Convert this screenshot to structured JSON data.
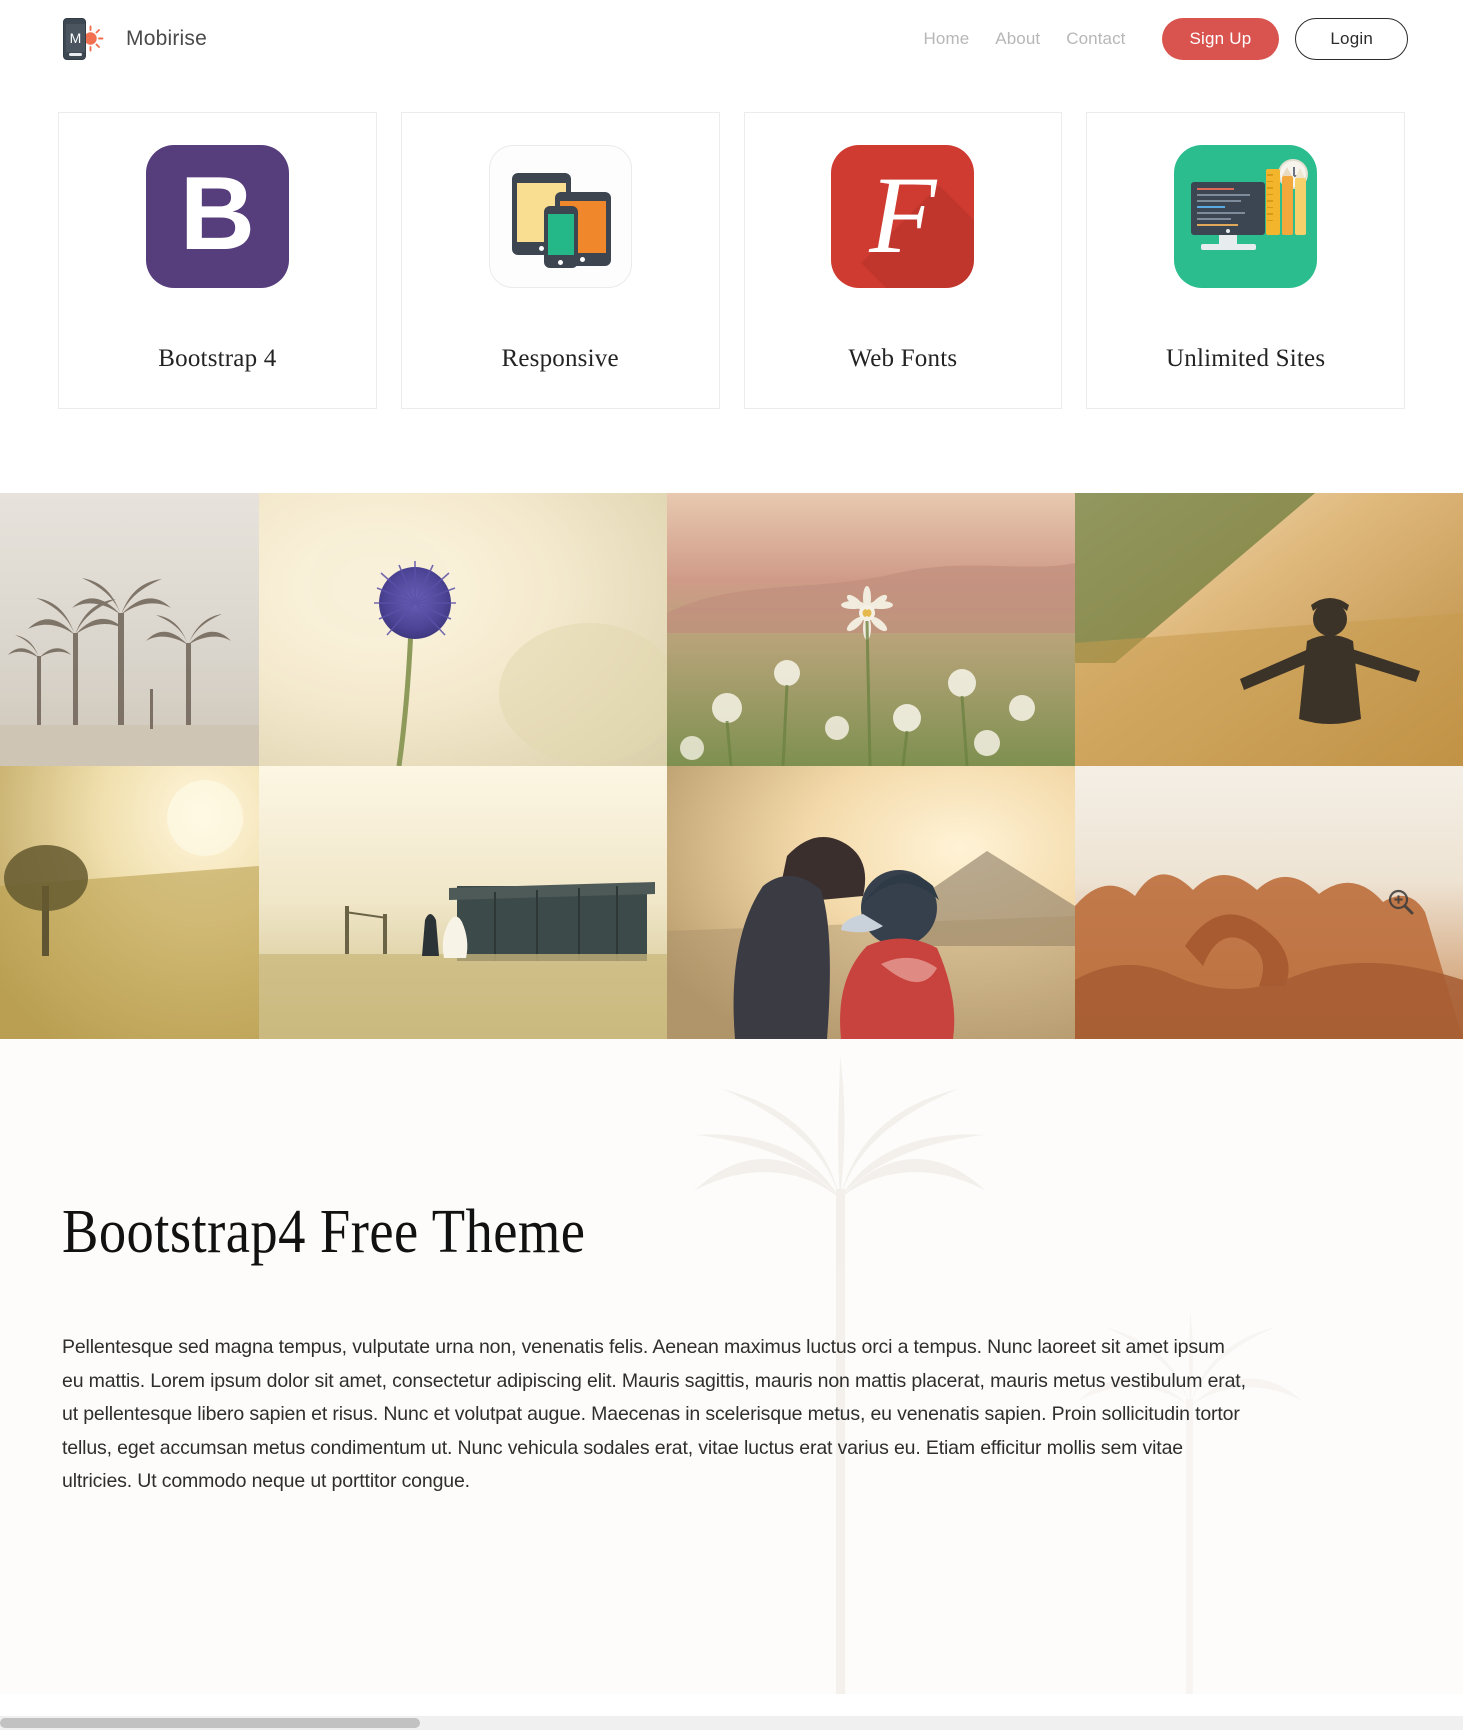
{
  "header": {
    "brand_name": "Mobirise",
    "logo_letter": "M",
    "logo_icon": "mobile-sunburst-icon",
    "nav_links": [
      {
        "label": "Home"
      },
      {
        "label": "About"
      },
      {
        "label": "Contact"
      }
    ],
    "signup_label": "Sign Up",
    "login_label": "Login",
    "accent_color": "#d9534f",
    "nav_link_color": "#b7b7b7"
  },
  "features": [
    {
      "label": "Bootstrap 4",
      "icon": "bootstrap-b-icon",
      "color": "#563d7c"
    },
    {
      "label": "Responsive",
      "icon": "devices-responsive-icon",
      "color": "#fdfdfd"
    },
    {
      "label": "Web Fonts",
      "icon": "font-awesome-f-icon",
      "color": "#cf3b31"
    },
    {
      "label": "Unlimited Sites",
      "icon": "workstation-tools-icon",
      "color": "#2cbd8e"
    }
  ],
  "gallery": {
    "zoom_icon": "magnifier-plus-icon",
    "rows": [
      [
        {
          "name": "palm-trees-beach-photo",
          "alt": "Palm trees on a beach"
        },
        {
          "name": "thistle-flower-photo",
          "alt": "Purple thistle flower close-up"
        },
        {
          "name": "daisy-field-photo",
          "alt": "Daisy field with hills"
        },
        {
          "name": "man-in-field-photo",
          "alt": "Man with arms outstretched in golden field"
        }
      ],
      [
        {
          "name": "lone-tree-sunrise-photo",
          "alt": "Lone tree at sunrise in a meadow"
        },
        {
          "name": "wedding-couple-barn-photo",
          "alt": "Couple walking in field near barn"
        },
        {
          "name": "kids-sunset-photo",
          "alt": "Children watching the sunset"
        },
        {
          "name": "red-rock-arch-photo",
          "alt": "Red rock arch formation"
        }
      ]
    ]
  },
  "hero": {
    "title": "Bootstrap4 Free Theme",
    "background": "palm-tree-watermark",
    "paragraph": "Pellentesque sed magna tempus, vulputate urna non, venenatis felis. Aenean maximus luctus orci a tempus. Nunc laoreet sit amet ipsum eu mattis. Lorem ipsum dolor sit amet, consectetur adipiscing elit. Mauris sagittis, mauris non mattis placerat, mauris metus vestibulum erat, ut pellentesque libero sapien et risus. Nunc et volutpat augue. Maecenas in scelerisque metus, eu venenatis sapien. Proin sollicitudin tortor tellus, eget accumsan metus condimentum ut. Nunc vehicula sodales erat, vitae luctus erat varius eu. Etiam efficitur mollis sem vitae ultricies. Ut commodo neque ut porttitor congue."
  }
}
